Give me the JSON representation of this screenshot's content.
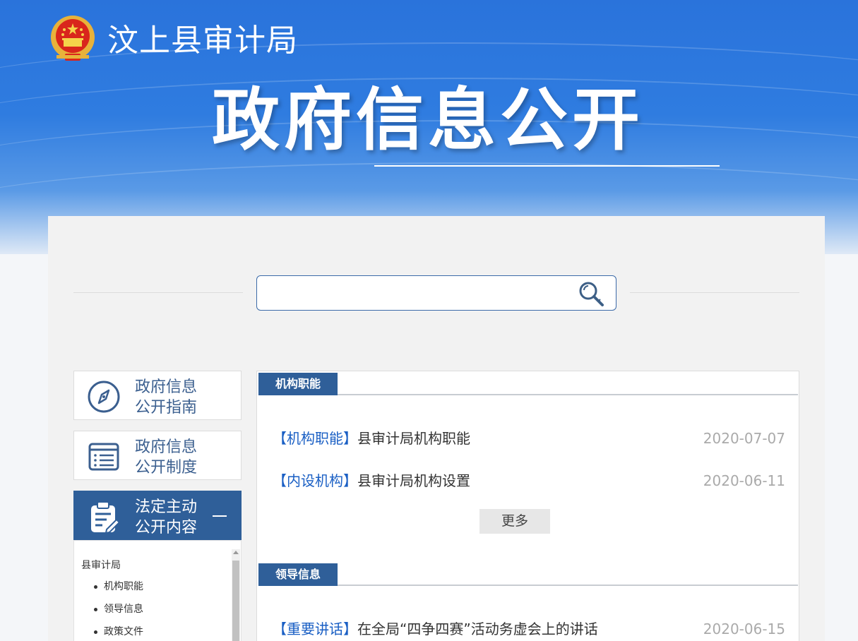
{
  "header": {
    "site_name": "汶上县审计局",
    "title": "政府信息公开"
  },
  "search": {
    "placeholder": ""
  },
  "sidebar": {
    "items": [
      {
        "label_line1": "政府信息",
        "label_line2": "公开指南",
        "icon": "compass-icon"
      },
      {
        "label_line1": "政府信息",
        "label_line2": "公开制度",
        "icon": "list-icon"
      },
      {
        "label_line1": "法定主动",
        "label_line2": "公开内容",
        "icon": "clipboard-edit-icon",
        "active": true
      }
    ],
    "tree": {
      "root": "县审计局",
      "children": [
        "机构职能",
        "领导信息",
        "政策文件"
      ]
    }
  },
  "sections": [
    {
      "title": "机构职能",
      "rows": [
        {
          "category": "【机构职能】",
          "title": "县审计局机构职能",
          "date": "2020-07-07"
        },
        {
          "category": "【内设机构】",
          "title": "县审计局机构设置",
          "date": "2020-06-11"
        }
      ],
      "more_label": "更多"
    },
    {
      "title": "领导信息",
      "rows": [
        {
          "category": "【重要讲话】",
          "title": "在全局“四争四赛”活动务虚会上的讲话",
          "date": "2020-06-15"
        }
      ]
    }
  ],
  "colors": {
    "banner_blue": "#2a73db",
    "accent_navy": "#2f5f99",
    "link_blue": "#1a5fc4"
  }
}
